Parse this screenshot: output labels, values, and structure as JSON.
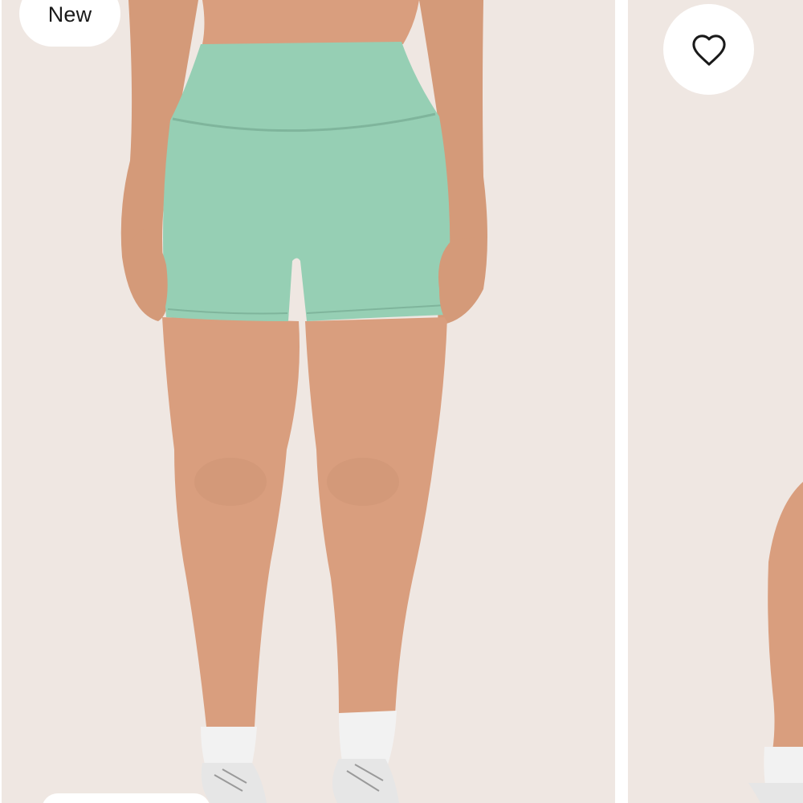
{
  "product_main": {
    "badge": "New"
  },
  "product_next": {
    "wishlist_icon": "heart-outline-icon"
  },
  "colors": {
    "card_background": "#efe7e2",
    "shorts": "#96cfb4",
    "skin": "#d99e7e"
  }
}
